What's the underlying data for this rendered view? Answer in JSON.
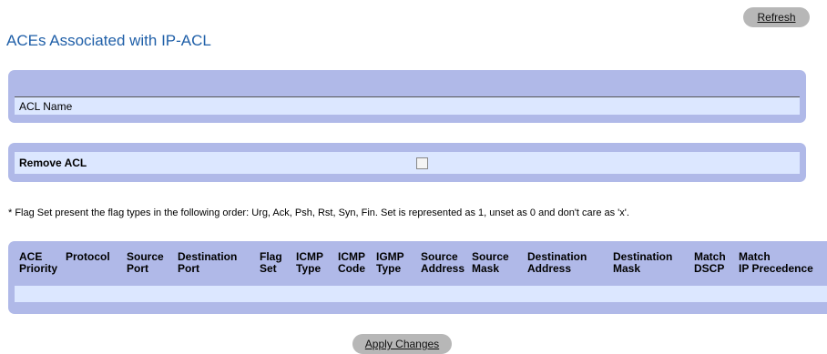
{
  "header": {
    "refresh_label": "Refresh",
    "title": "ACEs Associated with IP-ACL"
  },
  "acl": {
    "name_label": "ACL Name"
  },
  "remove": {
    "label": "Remove ACL",
    "checked": false
  },
  "note": "* Flag Set present the flag types in the following order: Urg, Ack, Psh, Rst, Syn, Fin. Set is represented as 1, unset as 0 and don't care as 'x'.",
  "table": {
    "columns": [
      {
        "line1": "ACE",
        "line2": "Priority"
      },
      {
        "line1": "Protocol",
        "line2": ""
      },
      {
        "line1": "Source",
        "line2": "Port"
      },
      {
        "line1": "Destination",
        "line2": "Port"
      },
      {
        "line1": "Flag",
        "line2": "Set"
      },
      {
        "line1": "ICMP",
        "line2": "Type"
      },
      {
        "line1": "ICMP",
        "line2": "Code"
      },
      {
        "line1": "IGMP",
        "line2": "Type"
      },
      {
        "line1": "Source",
        "line2": "Address"
      },
      {
        "line1": "Source",
        "line2": "Mask"
      },
      {
        "line1": "Destination",
        "line2": "Address"
      },
      {
        "line1": "Destination",
        "line2": "Mask"
      },
      {
        "line1": "Match",
        "line2": "DSCP"
      },
      {
        "line1": "Match",
        "line2": "IP Precedence"
      }
    ],
    "rows": []
  },
  "footer": {
    "apply_label": "Apply Changes"
  },
  "colors": {
    "title": "#1f5fa8",
    "panel": "#b0b9e8",
    "row": "#dce7ff",
    "button": "#b7b7b7"
  }
}
